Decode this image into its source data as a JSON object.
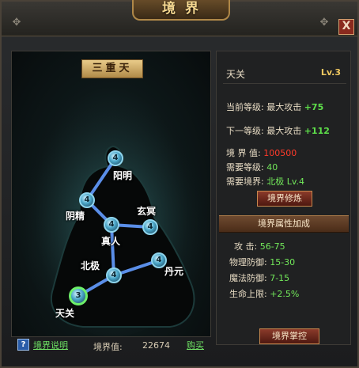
{
  "window": {
    "title": "境界",
    "close_glyph": "X"
  },
  "map": {
    "heading": "三重天",
    "nodes": [
      {
        "name": "阳明",
        "level": "4"
      },
      {
        "name": "阴精",
        "level": "4"
      },
      {
        "name": "真人",
        "level": "4"
      },
      {
        "name": "玄冥",
        "level": "4"
      },
      {
        "name": "北极",
        "level": "4"
      },
      {
        "name": "丹元",
        "level": "4"
      },
      {
        "name": "天关",
        "level": "3",
        "selected": true
      }
    ]
  },
  "info": {
    "realm_name": "天关",
    "level": "Lv.3",
    "current_label": "当前等级:",
    "current_stat": "最大攻击",
    "current_value": "+75",
    "next_label": "下一等级:",
    "next_stat": "最大攻击",
    "next_value": "+112",
    "points_label": "境 界 值:",
    "points_value": "100500",
    "req_level_label": "需要等级:",
    "req_level_value": "40",
    "req_realm_label": "需要境界:",
    "req_realm_value": "北极",
    "req_realm_lv": "Lv.4",
    "upgrade_button": "境界修炼",
    "bonus_header": "境界属性加成",
    "attrs": [
      {
        "label": "攻   击:",
        "value": "56-75"
      },
      {
        "label": "物理防御:",
        "value": "15-30"
      },
      {
        "label": "魔法防御:",
        "value": "7-15"
      },
      {
        "label": "生命上限:",
        "value": "+2.5%"
      }
    ],
    "master_button": "境界掌控"
  },
  "footer": {
    "help_glyph": "?",
    "help_link": "境界说明",
    "points_label": "境界值:",
    "points_value": "22674",
    "buy_link": "购买"
  },
  "colors": {
    "accent_gold": "#f0c860",
    "value_green": "#5ee04a",
    "warning_red": "#ff3a2a",
    "line_blue": "#5a8ee8"
  },
  "icons": [
    "rivet-icon",
    "close-icon",
    "help-icon",
    "realm-node-icon"
  ]
}
